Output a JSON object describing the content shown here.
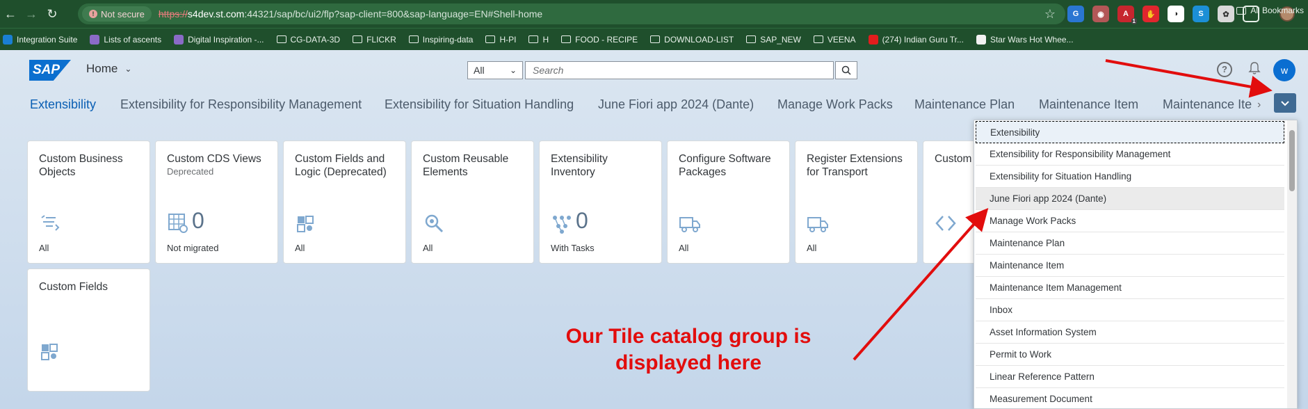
{
  "browser": {
    "security_label": "Not secure",
    "url_protocol": "https://",
    "url_host": "s4dev.st.com",
    "url_rest": ":44321/sap/bc/ui2/flp?sap-client=800&sap-language=EN#Shell-home",
    "bookmarks": [
      {
        "label": "Integration Suite",
        "icon": "sap-favicon"
      },
      {
        "label": "Lists of ascents",
        "icon": "site-favicon"
      },
      {
        "label": "Digital Inspiration -...",
        "icon": "site-favicon"
      },
      {
        "label": "CG-DATA-3D",
        "icon": "folder-icon"
      },
      {
        "label": "FLICKR",
        "icon": "folder-icon"
      },
      {
        "label": "Inspiring-data",
        "icon": "folder-icon"
      },
      {
        "label": "H-PI",
        "icon": "folder-icon"
      },
      {
        "label": "H",
        "icon": "folder-icon"
      },
      {
        "label": "FOOD - RECIPE",
        "icon": "folder-icon"
      },
      {
        "label": "DOWNLOAD-LIST",
        "icon": "folder-icon"
      },
      {
        "label": "SAP_NEW",
        "icon": "folder-icon"
      },
      {
        "label": "VEENA",
        "icon": "folder-icon"
      },
      {
        "label": "(274) Indian Guru Tr...",
        "icon": "youtube-icon"
      },
      {
        "label": "Star Wars Hot Whee...",
        "icon": "amazon-icon"
      }
    ],
    "all_bookmarks_label": "All Bookmarks",
    "extension_badge": "1"
  },
  "shell": {
    "logo_text": "SAP",
    "home_label": "Home",
    "scope_value": "All",
    "search_placeholder": "Search",
    "user_initial": "w"
  },
  "tabs": [
    {
      "label": "Extensibility",
      "active": true
    },
    {
      "label": "Extensibility for Responsibility Management"
    },
    {
      "label": "Extensibility for Situation Handling"
    },
    {
      "label": "June Fiori app 2024 (Dante)"
    },
    {
      "label": "Manage Work Packs"
    },
    {
      "label": "Maintenance Plan"
    },
    {
      "label": "Maintenance Item"
    },
    {
      "label": "Maintenance Ite"
    }
  ],
  "tiles": [
    {
      "title": "Custom Business Objects",
      "subtitle": "",
      "number": "",
      "footer": "All",
      "icon": "list-icon"
    },
    {
      "title": "Custom CDS Views",
      "subtitle": "Deprecated",
      "number": "0",
      "footer": "Not migrated",
      "icon": "grid-settings-icon"
    },
    {
      "title": "Custom Fields and Logic (Deprecated)",
      "subtitle": "",
      "number": "",
      "footer": "All",
      "icon": "puzzle-icon"
    },
    {
      "title": "Custom Reusable Elements",
      "subtitle": "",
      "number": "",
      "footer": "All",
      "icon": "search-gear-icon"
    },
    {
      "title": "Extensibility Inventory",
      "subtitle": "",
      "number": "0",
      "footer": "With Tasks",
      "icon": "network-icon"
    },
    {
      "title": "Configure Software Packages",
      "subtitle": "",
      "number": "",
      "footer": "All",
      "icon": "truck-icon"
    },
    {
      "title": "Register Extensions for Transport",
      "subtitle": "",
      "number": "",
      "footer": "All",
      "icon": "truck-icon"
    },
    {
      "title": "Custom",
      "subtitle": "",
      "number": "",
      "footer": "",
      "icon": "code-icon"
    },
    {
      "title": "Custom Fields",
      "subtitle": "",
      "number": "",
      "footer": "",
      "icon": "puzzle-icon"
    }
  ],
  "dropdown": {
    "items": [
      "Extensibility",
      "Extensibility for Responsibility Management",
      "Extensibility for Situation Handling",
      "June Fiori app 2024 (Dante)",
      "Manage Work Packs",
      "Maintenance Plan",
      "Maintenance Item",
      "Maintenance Item Management",
      "Inbox",
      "Asset Information System",
      "Permit to Work",
      "Linear Reference Pattern",
      "Measurement Document"
    ],
    "selected_index": 0,
    "hover_index": 3
  },
  "annotation": {
    "line1": "Our Tile catalog group is",
    "line2": "displayed here",
    "color": "#e20d0d"
  }
}
